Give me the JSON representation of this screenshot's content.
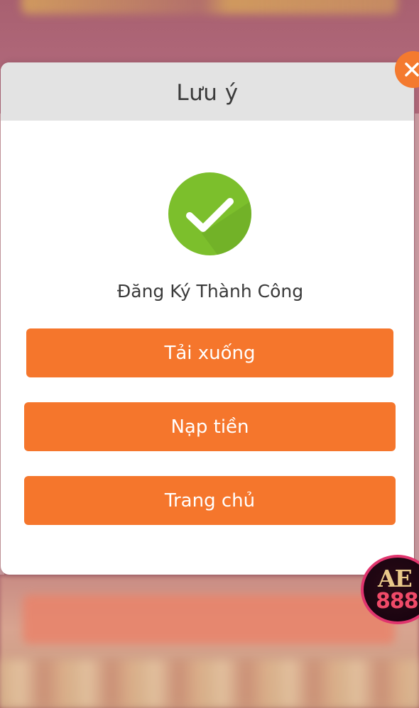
{
  "modal": {
    "title": "Lưu ý",
    "success_message": "Đăng Ký Thành Công",
    "buttons": {
      "download_label": "Tải xuống",
      "deposit_label": "Nạp tiền",
      "home_label": "Trang chủ"
    }
  },
  "badge": {
    "brand_letters": "AE",
    "brand_number": "888"
  },
  "icons": {
    "close": "close-icon",
    "success": "checkmark-icon"
  },
  "colors": {
    "accent": "#f5762c",
    "success": "#7cbf2c",
    "header_bg": "#e3e3e3",
    "badge_ring": "#e0356e"
  }
}
